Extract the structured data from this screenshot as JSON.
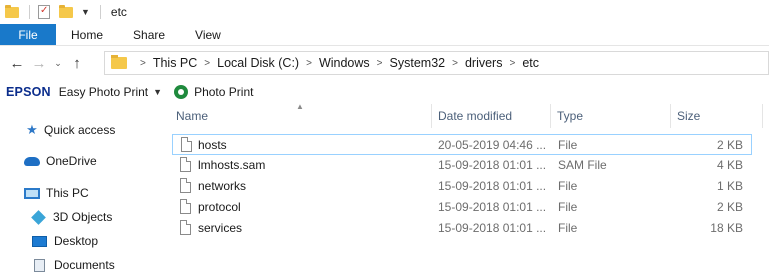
{
  "window": {
    "title": "etc"
  },
  "ribbon": {
    "file_label": "File",
    "tabs": [
      {
        "label": "Home"
      },
      {
        "label": "Share"
      },
      {
        "label": "View"
      }
    ]
  },
  "address": {
    "crumbs": [
      "This PC",
      "Local Disk (C:)",
      "Windows",
      "System32",
      "drivers",
      "etc"
    ]
  },
  "toolbar": {
    "brand": "EPSON",
    "easy_photo_print": "Easy Photo Print",
    "photo_print": "Photo Print"
  },
  "nav": {
    "quick_access": "Quick access",
    "onedrive": "OneDrive",
    "this_pc": "This PC",
    "objects_3d": "3D Objects",
    "desktop": "Desktop",
    "documents": "Documents"
  },
  "columns": {
    "name": "Name",
    "date": "Date modified",
    "type": "Type",
    "size": "Size"
  },
  "files": [
    {
      "name": "hosts",
      "date": "20-05-2019 04:46 ...",
      "type": "File",
      "size": "2 KB"
    },
    {
      "name": "lmhosts.sam",
      "date": "15-09-2018 01:01 ...",
      "type": "SAM File",
      "size": "4 KB"
    },
    {
      "name": "networks",
      "date": "15-09-2018 01:01 ...",
      "type": "File",
      "size": "1 KB"
    },
    {
      "name": "protocol",
      "date": "15-09-2018 01:01 ...",
      "type": "File",
      "size": "2 KB"
    },
    {
      "name": "services",
      "date": "15-09-2018 01:01 ...",
      "type": "File",
      "size": "18 KB"
    }
  ],
  "colors": {
    "file_tab": "#1979ca",
    "selection_border": "#99d1ff",
    "epson_blue": "#0b2d8c"
  }
}
